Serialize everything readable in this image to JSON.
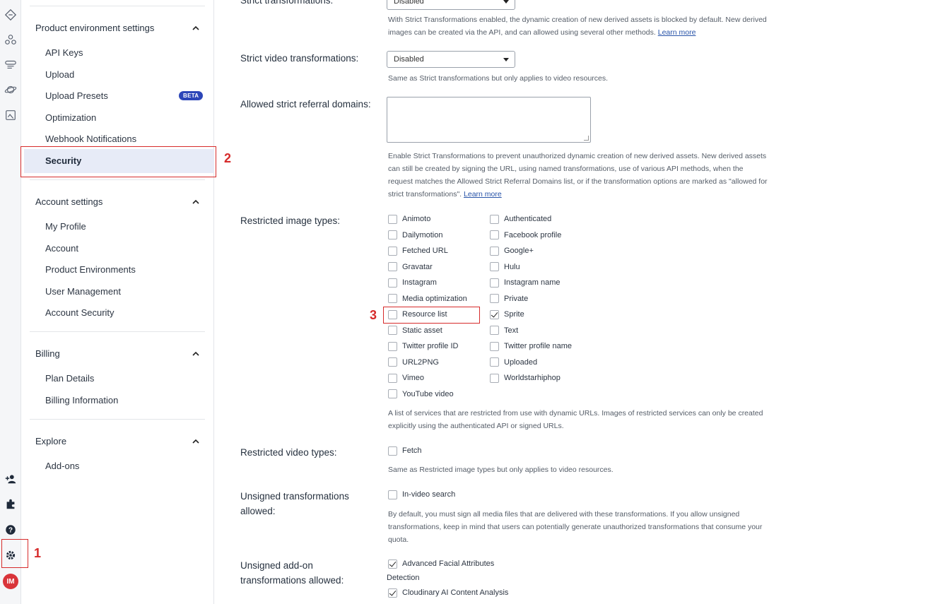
{
  "rail": {
    "icons": [
      "code-icon",
      "network-icon",
      "transform-icon",
      "planet-icon",
      "gallery-icon"
    ],
    "bottom_icons": [
      "add-user-icon",
      "puzzle-icon",
      "help-icon",
      "gear-icon"
    ],
    "avatar": "IM"
  },
  "nav": {
    "groups": [
      {
        "title": "Product environment settings",
        "items": [
          "API Keys",
          "Upload",
          "Upload Presets",
          "Optimization",
          "Webhook Notifications",
          "Security"
        ]
      },
      {
        "title": "Account settings",
        "items": [
          "My Profile",
          "Account",
          "Product Environments",
          "User Management",
          "Account Security"
        ]
      },
      {
        "title": "Billing",
        "items": [
          "Plan Details",
          "Billing Information"
        ]
      },
      {
        "title": "Explore",
        "items": [
          "Add-ons"
        ]
      }
    ],
    "beta_badge": "BETA",
    "active_item": "Security"
  },
  "annotations": [
    "1",
    "2",
    "3"
  ],
  "main": {
    "strict_transformations": {
      "label": "Strict transformations:",
      "value": "Disabled",
      "help": "With Strict Transformations enabled, the dynamic creation of new derived assets is blocked by default. New derived images can be created via the API, and can allowed using several other methods.",
      "link": "Learn more"
    },
    "strict_video": {
      "label": "Strict video transformations:",
      "value": "Disabled",
      "help": "Same as Strict transformations but only applies to video resources."
    },
    "referral_domains": {
      "label": "Allowed strict referral domains:",
      "help": "Enable Strict Transformations to prevent unauthorized dynamic creation of new derived assets. New derived assets can still be created by signing the URL, using named transformations, use of various API methods, when the request matches the Allowed Strict Referral Domains list, or if the transformation options are marked as \"allowed for strict transformations\".",
      "link": "Learn more"
    },
    "restricted_image": {
      "label": "Restricted image types:",
      "col1": [
        "Animoto",
        "Dailymotion",
        "Fetched URL",
        "Gravatar",
        "Instagram",
        "Media optimization",
        "Resource list",
        "Static asset",
        "Twitter profile ID",
        "URL2PNG",
        "Vimeo",
        "YouTube video"
      ],
      "col2": [
        "Authenticated",
        "Facebook profile",
        "Google+",
        "Hulu",
        "Instagram name",
        "Private",
        "Sprite",
        "Text",
        "Twitter profile name",
        "Uploaded",
        "Worldstarhiphop"
      ],
      "checked": [
        "Sprite"
      ],
      "help": "A list of services that are restricted from use with dynamic URLs. Images of restricted services can only be created explicitly using the authenticated API or signed URLs."
    },
    "restricted_video": {
      "label": "Restricted video types:",
      "option": "Fetch",
      "help": "Same as Restricted image types but only applies to video resources."
    },
    "unsigned_transformations": {
      "label_line1": "Unsigned transformations",
      "label_line2": "allowed:",
      "option": "In-video search",
      "help": "By default, you must sign all media files that are delivered with these transformations. If you allow unsigned transformations, keep in mind that users can potentially generate unauthorized transformations that consume your quota."
    },
    "unsigned_addon": {
      "label_line1": "Unsigned add-on",
      "label_line2": "transformations allowed:",
      "option1": "Advanced Facial Attributes",
      "option1_cont": "Detection",
      "option2": "Cloudinary AI Content Analysis"
    }
  }
}
